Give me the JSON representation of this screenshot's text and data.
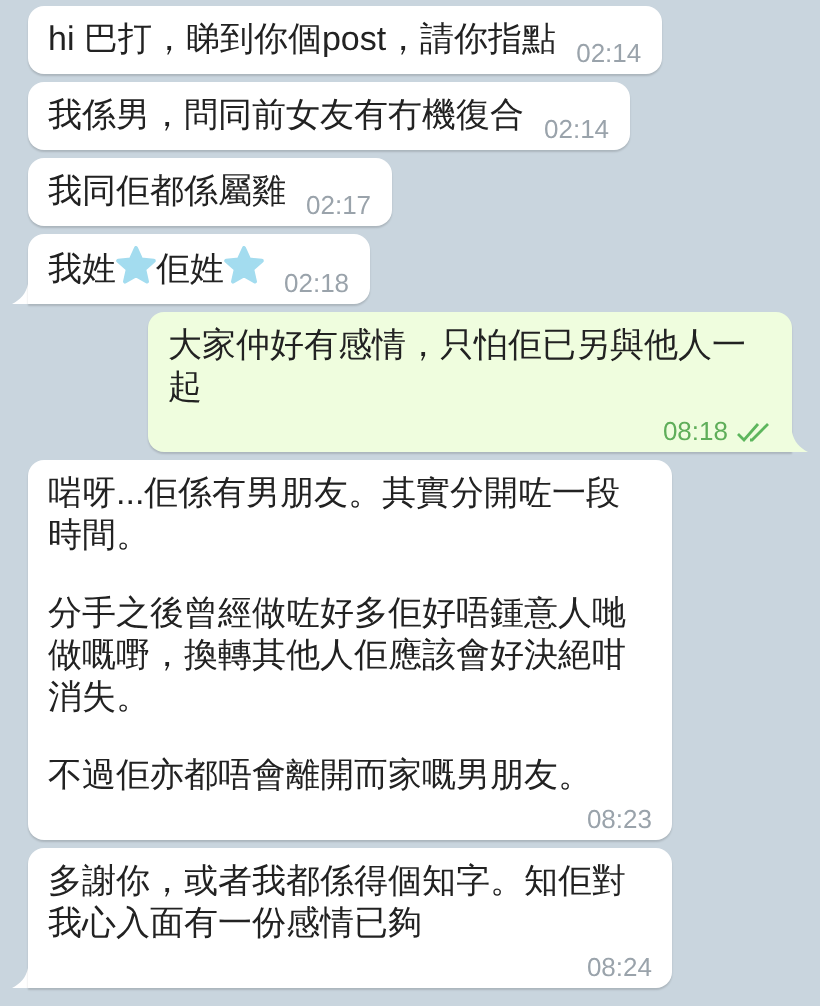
{
  "messages": [
    {
      "outgoing": false,
      "tail": false,
      "paragraphs": [
        [
          {
            "kind": "text",
            "text": "hi 巴打，睇到你個post，請你指點"
          }
        ]
      ],
      "time": "02:14"
    },
    {
      "outgoing": false,
      "tail": false,
      "paragraphs": [
        [
          {
            "kind": "text",
            "text": "我係男，問同前女友有冇機復合"
          }
        ]
      ],
      "time": "02:14"
    },
    {
      "outgoing": false,
      "tail": false,
      "paragraphs": [
        [
          {
            "kind": "text",
            "text": "我同佢都係屬雞"
          }
        ]
      ],
      "time": "02:17"
    },
    {
      "outgoing": false,
      "tail": true,
      "paragraphs": [
        [
          {
            "kind": "text",
            "text": "我姓"
          },
          {
            "kind": "star"
          },
          {
            "kind": "text",
            "text": "佢姓"
          },
          {
            "kind": "star"
          }
        ]
      ],
      "time": "02:18"
    },
    {
      "outgoing": true,
      "tail": true,
      "read": true,
      "paragraphs": [
        [
          {
            "kind": "text",
            "text": "大家仲好有感情，只怕佢已另與他人一起"
          }
        ]
      ],
      "time": "08:18"
    },
    {
      "outgoing": false,
      "tail": false,
      "paragraphs": [
        [
          {
            "kind": "text",
            "text": "啱呀...佢係有男朋友。其實分開咗一段時間。"
          }
        ],
        [
          {
            "kind": "text",
            "text": "分手之後曾經做咗好多佢好唔鍾意人哋做嘅嘢，換轉其他人佢應該會好決絕咁消失。"
          }
        ],
        [
          {
            "kind": "text",
            "text": "不過佢亦都唔會離開而家嘅男朋友。"
          }
        ]
      ],
      "time": "08:23"
    },
    {
      "outgoing": false,
      "tail": true,
      "paragraphs": [
        [
          {
            "kind": "text",
            "text": "多謝你，或者我都係得個知字。知佢對我心入面有一份感情已夠"
          }
        ]
      ],
      "time": "08:24"
    }
  ]
}
